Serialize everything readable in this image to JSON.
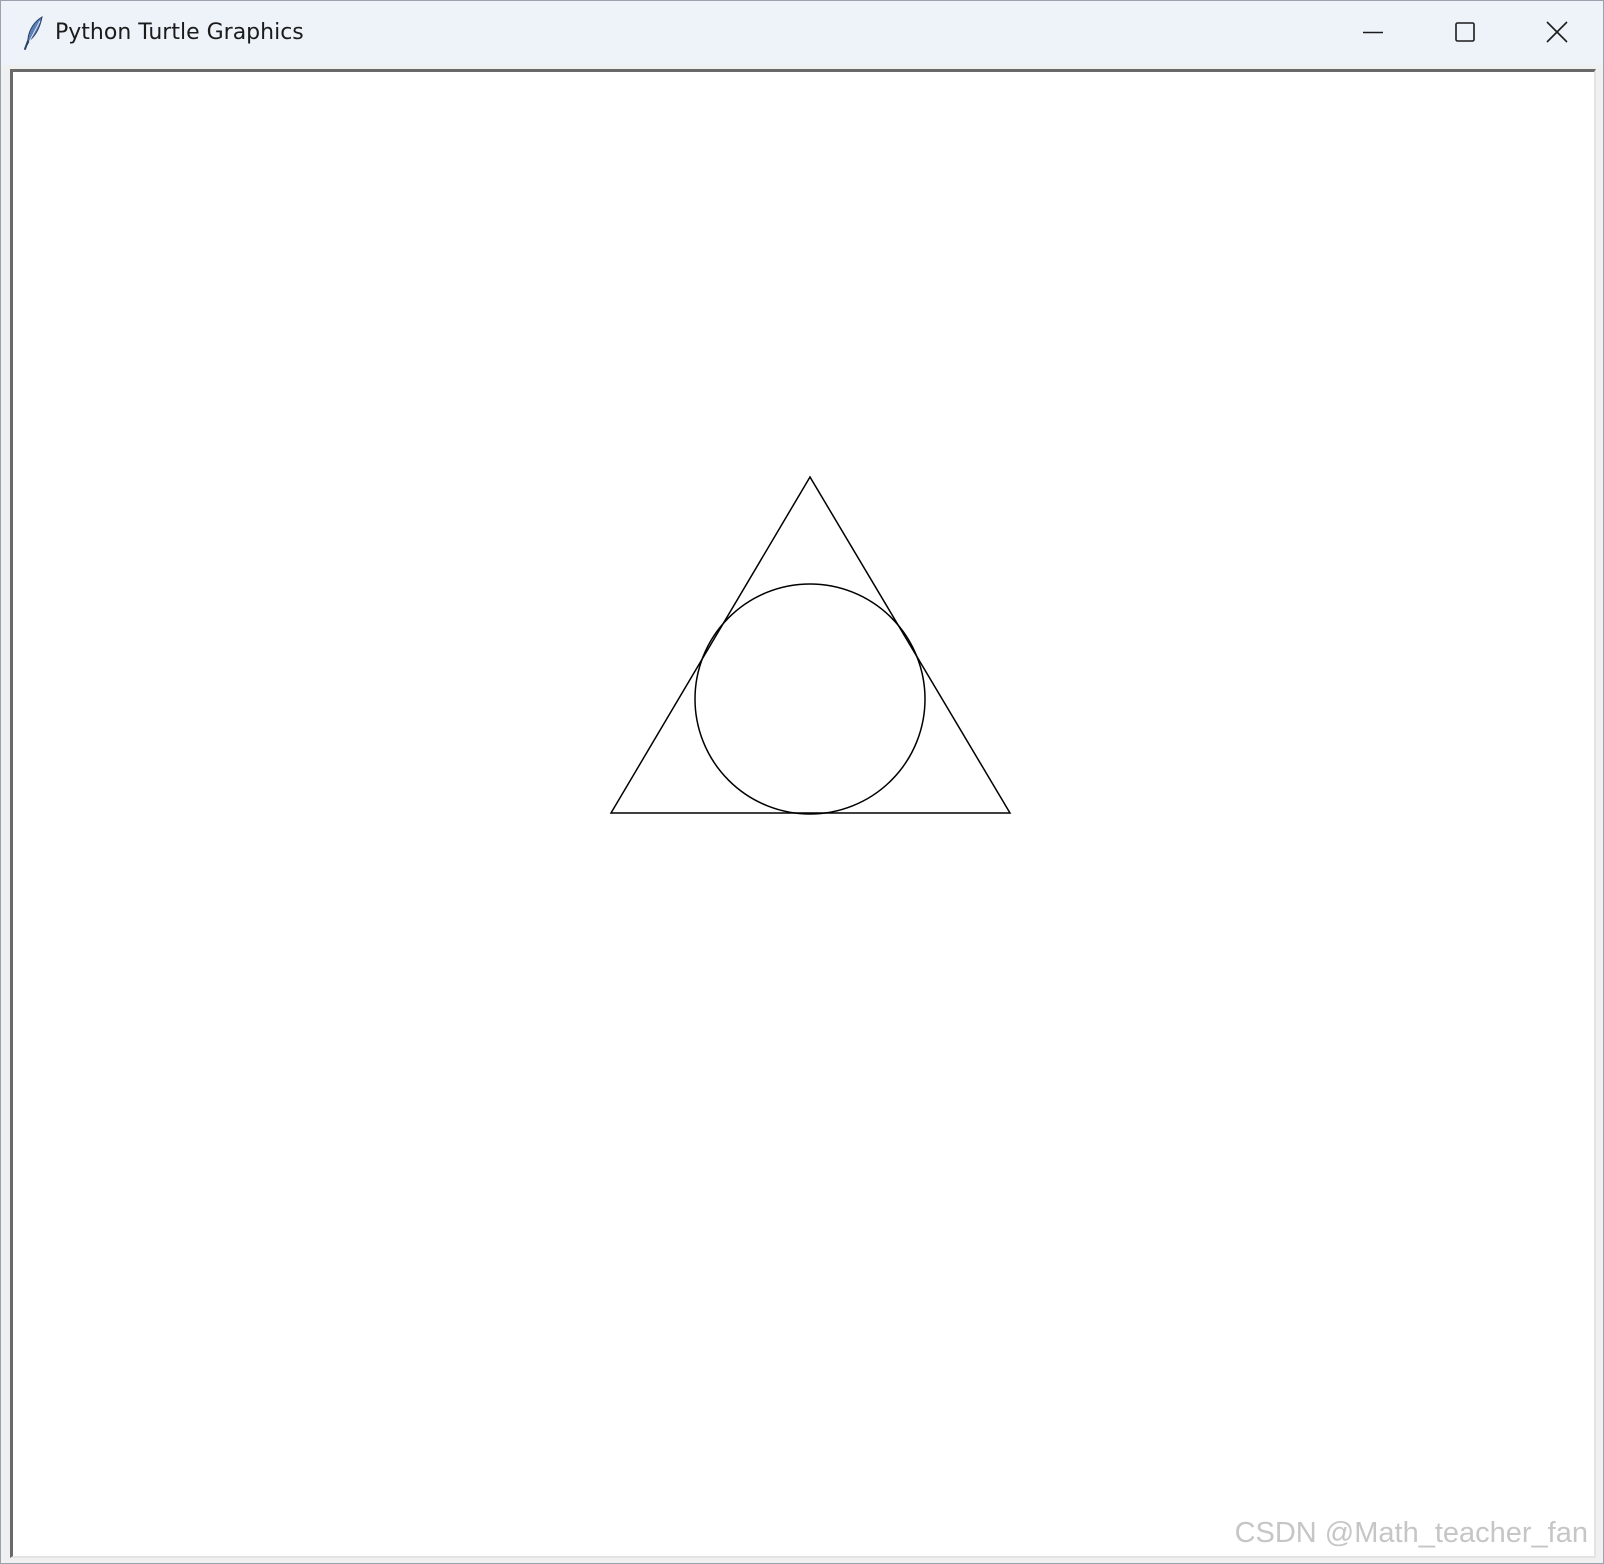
{
  "window": {
    "title": "Python Turtle Graphics",
    "icon": "feather-icon",
    "controls": {
      "minimize_icon": "minimize-icon",
      "maximize_icon": "maximize-icon",
      "close_icon": "close-icon"
    }
  },
  "canvas": {
    "background": "#ffffff",
    "stroke_color": "#000000",
    "shapes": [
      {
        "kind": "triangle",
        "description": "equilateral triangle"
      },
      {
        "kind": "circle",
        "description": "inscribed circle"
      }
    ]
  },
  "watermark": {
    "text": "CSDN @Math_teacher_fan"
  },
  "colors": {
    "titlebar": "#eef3fa",
    "frame": "#f0f0f0",
    "canvas": "#ffffff",
    "watermark": "#c6c6c6"
  }
}
